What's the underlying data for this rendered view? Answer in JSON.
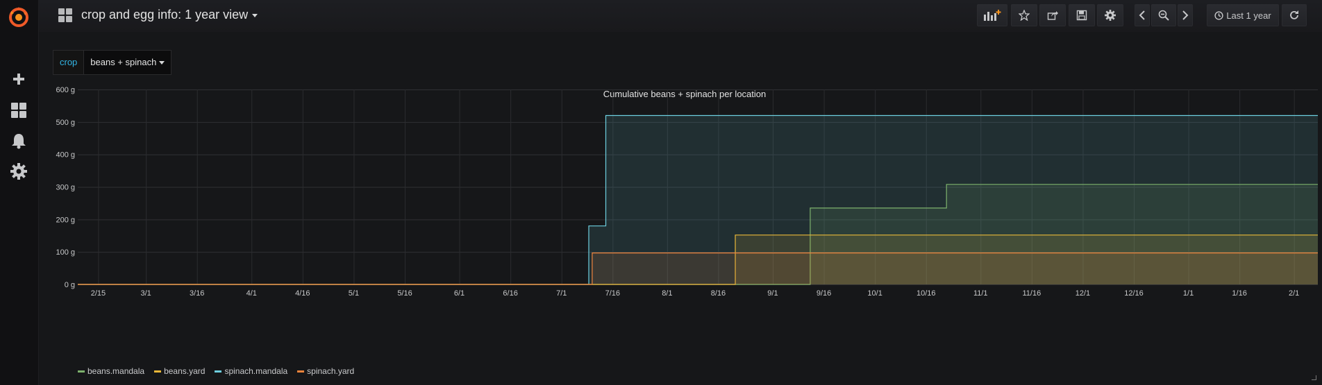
{
  "sidebar": {
    "items": [
      {
        "icon": "plus-icon",
        "label": "Create"
      },
      {
        "icon": "dashboards-icon",
        "label": "Dashboards"
      },
      {
        "icon": "bell-icon",
        "label": "Alerting"
      },
      {
        "icon": "gear-icon",
        "label": "Configuration"
      }
    ]
  },
  "header": {
    "title": "crop and egg info: 1 year view",
    "time_range": "Last 1 year"
  },
  "variable": {
    "label": "crop",
    "value": "beans + spinach"
  },
  "colors": {
    "beans.mandala": "#7eb26d",
    "beans.yard": "#eab839",
    "spinach.mandala": "#6ed0e0",
    "spinach.yard": "#ef843c"
  },
  "chart_data": {
    "type": "area",
    "title": "Cumulative beans + spinach per location",
    "x_tick_labels": [
      "2/15",
      "3/1",
      "3/16",
      "4/1",
      "4/16",
      "5/1",
      "5/16",
      "6/1",
      "6/16",
      "7/1",
      "7/16",
      "8/1",
      "8/16",
      "9/1",
      "9/16",
      "10/1",
      "10/16",
      "11/1",
      "11/16",
      "12/1",
      "12/16",
      "1/1",
      "1/16",
      "2/1"
    ],
    "x_tick_days": [
      0,
      14,
      29,
      45,
      60,
      75,
      90,
      106,
      121,
      136,
      151,
      167,
      182,
      198,
      213,
      228,
      243,
      259,
      274,
      289,
      304,
      320,
      335,
      351
    ],
    "y_tick_labels": [
      "0 g",
      "100 g",
      "200 g",
      "300 g",
      "400 g",
      "500 g",
      "600 g"
    ],
    "ylim": [
      0,
      600
    ],
    "x_domain_days": [
      -6,
      358
    ],
    "grid": true,
    "legend_position": "bottom-left",
    "series": [
      {
        "name": "beans.mandala",
        "step_points": [
          [
            -6,
            0
          ],
          [
            209,
            0
          ],
          [
            209,
            235
          ],
          [
            249,
            235
          ],
          [
            249,
            308
          ],
          [
            358,
            308
          ]
        ]
      },
      {
        "name": "beans.yard",
        "step_points": [
          [
            -6,
            0
          ],
          [
            187,
            0
          ],
          [
            187,
            152
          ],
          [
            358,
            152
          ]
        ]
      },
      {
        "name": "spinach.mandala",
        "step_points": [
          [
            -6,
            0
          ],
          [
            144,
            0
          ],
          [
            144,
            180
          ],
          [
            149,
            180
          ],
          [
            149,
            520
          ],
          [
            358,
            520
          ]
        ]
      },
      {
        "name": "spinach.yard",
        "step_points": [
          [
            -6,
            0
          ],
          [
            145,
            0
          ],
          [
            145,
            97
          ],
          [
            358,
            97
          ]
        ]
      }
    ]
  }
}
